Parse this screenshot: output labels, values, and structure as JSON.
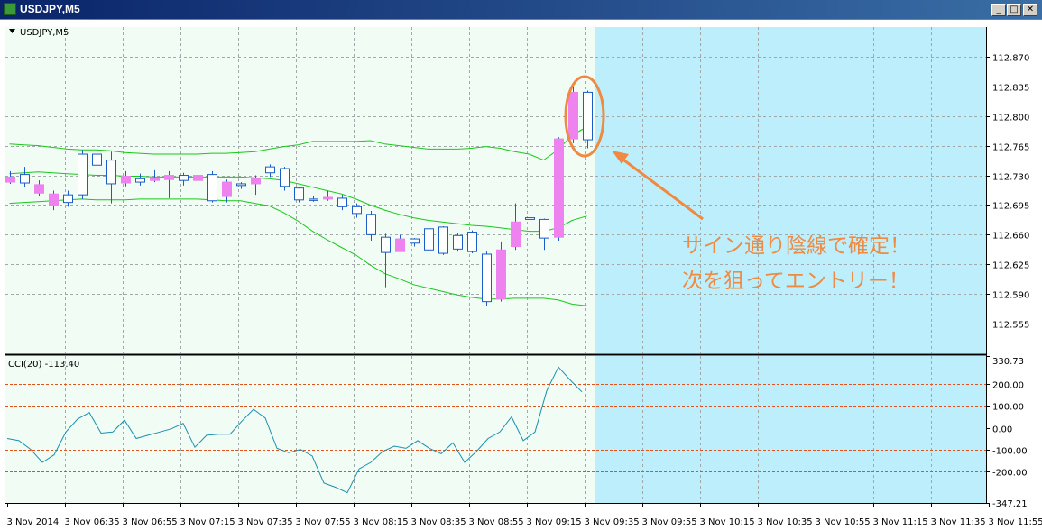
{
  "window": {
    "title": "USDJPY,M5",
    "minimize_glyph": "_",
    "restore_glyph": "□",
    "close_glyph": "✕"
  },
  "colors": {
    "background": "#f0fcf4",
    "future_zone": "#bdeefc",
    "bull": "#ffffff",
    "bear": "#ee82ee",
    "wick_bull": "#1c5cc8",
    "band": "#19c819",
    "cci_line": "#1a90b0",
    "levels": "#e0521c",
    "annotation": "#f08a40",
    "grid": "#a0a8a8"
  },
  "chart_data": [
    {
      "type": "candlestick",
      "title": "USDJPY,M5",
      "ylim": [
        112.52,
        112.905
      ],
      "y_ticks": [
        "112.870",
        "112.835",
        "112.800",
        "112.765",
        "112.730",
        "112.695",
        "112.660",
        "112.625",
        "112.590",
        "112.555"
      ],
      "y_tick_values": [
        112.87,
        112.835,
        112.8,
        112.765,
        112.73,
        112.695,
        112.66,
        112.625,
        112.59,
        112.555
      ],
      "x_labels": [
        "3 Nov 2014",
        "3 Nov 06:35",
        "3 Nov 06:55",
        "3 Nov 07:15",
        "3 Nov 07:35",
        "3 Nov 07:55",
        "3 Nov 08:15",
        "3 Nov 08:35",
        "3 Nov 08:55",
        "3 Nov 09:15",
        "3 Nov 09:35",
        "3 Nov 09:55",
        "3 Nov 10:15",
        "3 Nov 10:35",
        "3 Nov 10:55",
        "3 Nov 11:15",
        "3 Nov 11:35",
        "3 Nov 11:55"
      ],
      "candles": [
        {
          "o": 112.728,
          "h": 112.735,
          "l": 112.72,
          "c": 112.722
        },
        {
          "o": 112.721,
          "h": 112.74,
          "l": 112.716,
          "c": 112.731
        },
        {
          "o": 112.719,
          "h": 112.724,
          "l": 112.705,
          "c": 112.709
        },
        {
          "o": 112.708,
          "h": 112.712,
          "l": 112.689,
          "c": 112.695
        },
        {
          "o": 112.698,
          "h": 112.712,
          "l": 112.693,
          "c": 112.707
        },
        {
          "o": 112.707,
          "h": 112.76,
          "l": 112.702,
          "c": 112.755
        },
        {
          "o": 112.742,
          "h": 112.762,
          "l": 112.737,
          "c": 112.755
        },
        {
          "o": 112.72,
          "h": 112.758,
          "l": 112.697,
          "c": 112.748
        },
        {
          "o": 112.729,
          "h": 112.735,
          "l": 112.717,
          "c": 112.721
        },
        {
          "o": 112.722,
          "h": 112.732,
          "l": 112.718,
          "c": 112.726
        },
        {
          "o": 112.727,
          "h": 112.736,
          "l": 112.722,
          "c": 112.724
        },
        {
          "o": 112.73,
          "h": 112.735,
          "l": 112.703,
          "c": 112.725
        },
        {
          "o": 112.724,
          "h": 112.733,
          "l": 112.718,
          "c": 112.73
        },
        {
          "o": 112.73,
          "h": 112.733,
          "l": 112.721,
          "c": 112.724
        },
        {
          "o": 112.7,
          "h": 112.735,
          "l": 112.698,
          "c": 112.731
        },
        {
          "o": 112.722,
          "h": 112.725,
          "l": 112.698,
          "c": 112.705
        },
        {
          "o": 112.718,
          "h": 112.722,
          "l": 112.714,
          "c": 112.72
        },
        {
          "o": 112.727,
          "h": 112.73,
          "l": 112.707,
          "c": 112.72
        },
        {
          "o": 112.733,
          "h": 112.743,
          "l": 112.728,
          "c": 112.74
        },
        {
          "o": 112.717,
          "h": 112.74,
          "l": 112.712,
          "c": 112.738
        },
        {
          "o": 112.701,
          "h": 112.716,
          "l": 112.698,
          "c": 112.715
        },
        {
          "o": 112.701,
          "h": 112.705,
          "l": 112.699,
          "c": 112.702
        },
        {
          "o": 112.704,
          "h": 112.712,
          "l": 112.7,
          "c": 112.702
        },
        {
          "o": 112.693,
          "h": 112.707,
          "l": 112.689,
          "c": 112.703
        },
        {
          "o": 112.685,
          "h": 112.697,
          "l": 112.68,
          "c": 112.693
        },
        {
          "o": 112.66,
          "h": 112.688,
          "l": 112.653,
          "c": 112.684
        },
        {
          "o": 112.639,
          "h": 112.661,
          "l": 112.598,
          "c": 112.657
        },
        {
          "o": 112.655,
          "h": 112.66,
          "l": 112.64,
          "c": 112.64
        },
        {
          "o": 112.65,
          "h": 112.656,
          "l": 112.646,
          "c": 112.655
        },
        {
          "o": 112.642,
          "h": 112.669,
          "l": 112.637,
          "c": 112.667
        },
        {
          "o": 112.638,
          "h": 112.67,
          "l": 112.636,
          "c": 112.669
        },
        {
          "o": 112.643,
          "h": 112.662,
          "l": 112.64,
          "c": 112.659
        },
        {
          "o": 112.64,
          "h": 112.665,
          "l": 112.638,
          "c": 112.663
        },
        {
          "o": 112.581,
          "h": 112.64,
          "l": 112.576,
          "c": 112.637
        },
        {
          "o": 112.642,
          "h": 112.652,
          "l": 112.581,
          "c": 112.584
        },
        {
          "o": 112.675,
          "h": 112.697,
          "l": 112.642,
          "c": 112.646
        },
        {
          "o": 112.678,
          "h": 112.69,
          "l": 112.67,
          "c": 112.68
        },
        {
          "o": 112.656,
          "h": 112.679,
          "l": 112.642,
          "c": 112.678
        },
        {
          "o": 112.773,
          "h": 112.775,
          "l": 112.653,
          "c": 112.657
        },
        {
          "o": 112.828,
          "h": 112.837,
          "l": 112.768,
          "c": 112.773
        },
        {
          "o": 112.772,
          "h": 112.83,
          "l": 112.762,
          "c": 112.828
        }
      ],
      "bands": {
        "upper": [
          112.767,
          112.766,
          112.765,
          112.763,
          112.761,
          112.76,
          112.76,
          112.759,
          112.757,
          112.756,
          112.755,
          112.755,
          112.755,
          112.755,
          112.756,
          112.756,
          112.757,
          112.758,
          112.761,
          112.764,
          112.766,
          112.77,
          112.77,
          112.77,
          112.77,
          112.771,
          112.767,
          112.765,
          112.763,
          112.761,
          112.761,
          112.761,
          112.762,
          112.764,
          112.762,
          112.758,
          112.755,
          112.748,
          112.76,
          112.778,
          112.787
        ],
        "middle": [
          112.732,
          112.733,
          112.734,
          112.733,
          112.732,
          112.731,
          112.73,
          112.73,
          112.729,
          112.729,
          112.728,
          112.728,
          112.728,
          112.728,
          112.728,
          112.728,
          112.728,
          112.727,
          112.726,
          112.724,
          112.72,
          112.716,
          112.712,
          112.708,
          112.702,
          112.695,
          112.689,
          112.684,
          112.68,
          112.677,
          112.675,
          112.673,
          112.671,
          112.67,
          112.668,
          112.666,
          112.664,
          112.664,
          112.668,
          112.677,
          112.682
        ],
        "lower": [
          112.697,
          112.698,
          112.699,
          112.7,
          112.701,
          112.702,
          112.701,
          112.701,
          112.701,
          112.702,
          112.702,
          112.702,
          112.702,
          112.702,
          112.701,
          112.7,
          112.7,
          112.697,
          112.694,
          112.686,
          112.676,
          112.664,
          112.654,
          112.645,
          112.636,
          112.624,
          112.614,
          112.608,
          112.601,
          112.597,
          112.593,
          112.589,
          112.586,
          112.584,
          112.584,
          112.585,
          112.585,
          112.585,
          112.583,
          112.578,
          112.576
        ]
      }
    },
    {
      "type": "line",
      "title": "CCI(20) -113.40",
      "ylim": [
        -347.21,
        330.73
      ],
      "y_ticks": [
        "330.73",
        "200.00",
        "100.00",
        "0.00",
        "-100.00",
        "-200.00",
        "-347.21"
      ],
      "y_tick_values": [
        330.73,
        200,
        100,
        0,
        -100,
        -200,
        -347.21
      ],
      "levels": [
        200,
        100,
        -100,
        -200
      ],
      "values": [
        -50,
        -60,
        -100,
        -160,
        -125,
        -20,
        40,
        70,
        -25,
        -20,
        35,
        -50,
        -35,
        -20,
        -5,
        20,
        -90,
        -35,
        -30,
        -30,
        30,
        85,
        45,
        -95,
        -115,
        -100,
        -130,
        -255,
        -275,
        -300,
        -190,
        -160,
        -110,
        -85,
        -95,
        -60,
        -95,
        -120,
        -70,
        -160,
        -110,
        -50,
        -20,
        50,
        -60,
        -20,
        170,
        280,
        220,
        165
      ]
    }
  ],
  "annotation": {
    "line1": "サイン通り陰線で確定！",
    "line2": "次を狙ってエントリー！"
  }
}
